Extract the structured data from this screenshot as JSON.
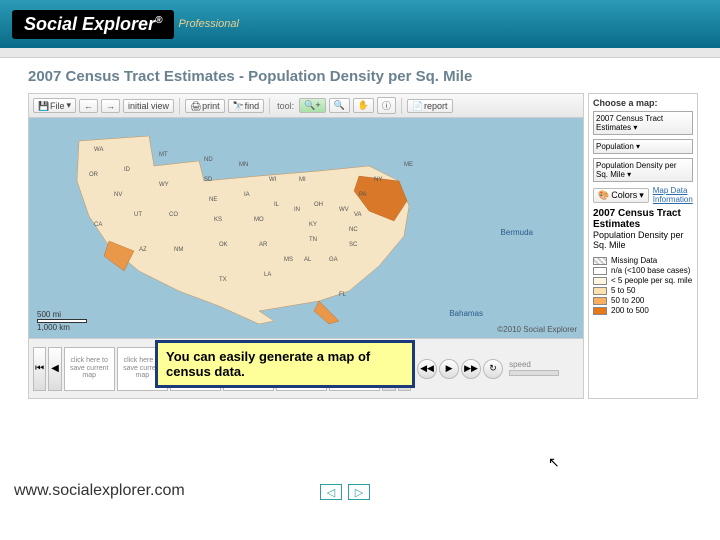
{
  "header": {
    "brand": "Social Explorer",
    "reg": "®",
    "edition": "Professional"
  },
  "title": "2007 Census Tract Estimates - Population Density per Sq. Mile",
  "toolbar": {
    "file": "File",
    "back": "←",
    "fwd": "→",
    "initial": "initial view",
    "print": "print",
    "find": "find",
    "tool_label": "tool:",
    "zoom_in": "🔍+",
    "zoom_out": "🔍",
    "pan": "✋",
    "info": "ⓘ",
    "report": "report"
  },
  "map": {
    "scale_text": "500 mi",
    "scale_sub": "1,000 km",
    "label_bermuda": "Bermuda",
    "label_bahamas": "Bahamas",
    "copyright": "©2010 Social Explorer",
    "states": [
      "WA",
      "OR",
      "CA",
      "NV",
      "ID",
      "MT",
      "WY",
      "UT",
      "AZ",
      "CO",
      "NM",
      "ND",
      "SD",
      "NE",
      "KS",
      "OK",
      "TX",
      "MN",
      "IA",
      "MO",
      "AR",
      "LA",
      "WI",
      "IL",
      "MS",
      "MI",
      "IN",
      "OH",
      "KY",
      "TN",
      "AL",
      "GA",
      "FL",
      "SC",
      "NC",
      "VA",
      "WV",
      "PA",
      "NY",
      "ME"
    ]
  },
  "filmstrip": {
    "first": "⏮",
    "prev": "◀",
    "next": "▶",
    "last": "⏭",
    "frame_text": "click here to save current map",
    "play_back": "◀◀",
    "play": "▶",
    "play_fwd": "▶▶",
    "loop": "↻",
    "speed_label": "speed"
  },
  "sidebar": {
    "choose_label": "Choose a map:",
    "dataset": "2007 Census Tract Estimates",
    "category": "Population",
    "variable": "Population Density per Sq. Mile",
    "colors_label": "Colors",
    "mapdata_link": "Map Data Information",
    "title": "2007 Census Tract Estimates",
    "subtitle": "Population Density per Sq. Mile",
    "legend": [
      {
        "label": "Missing Data",
        "color": "#ffffff",
        "hatch": true
      },
      {
        "label": "n/a (<100 base cases)",
        "color": "#ffffff"
      },
      {
        "label": "< 5 people per sq. mile",
        "color": "#fff5e0"
      },
      {
        "label": "5 to 50",
        "color": "#fde0b0"
      },
      {
        "label": "50 to 200",
        "color": "#f8b060"
      },
      {
        "label": "200 to 500",
        "color": "#e87818"
      }
    ]
  },
  "callout": "You can easily generate a map of census data.",
  "footer": {
    "url": "www.socialexplorer.com"
  }
}
